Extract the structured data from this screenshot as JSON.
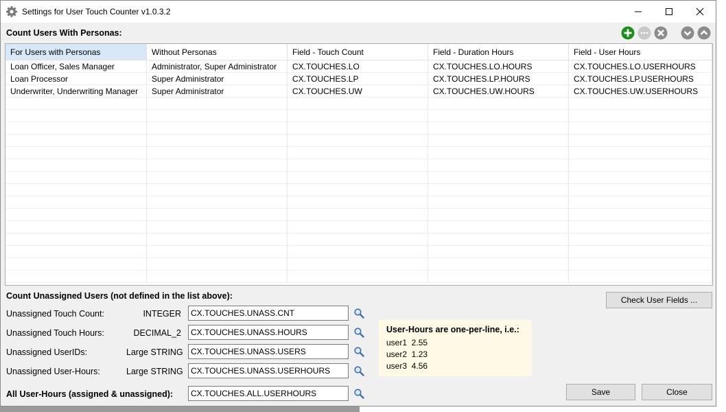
{
  "window": {
    "title": "Settings for User Touch Counter v1.0.3.2",
    "icons": [
      "gear-icon",
      "minimize-icon",
      "maximize-icon",
      "close-icon"
    ]
  },
  "personas": {
    "section_label": "Count Users With Personas:",
    "toolbar_icons": [
      "add-icon",
      "edit-icon",
      "remove-icon",
      "move-down-icon",
      "move-up-icon"
    ],
    "accent_add": "#1a8f1a",
    "columns": [
      "For Users with Personas",
      "Without Personas",
      "Field - Touch Count",
      "Field - Duration Hours",
      "Field - User Hours"
    ],
    "rows": [
      [
        "Loan Officer, Sales Manager",
        "Administrator, Super Administrator",
        "CX.TOUCHES.LO",
        "CX.TOUCHES.LO.HOURS",
        "CX.TOUCHES.LO.USERHOURS"
      ],
      [
        "Loan Processor",
        "Super Administrator",
        "CX.TOUCHES.LP",
        "CX.TOUCHES.LP.HOURS",
        "CX.TOUCHES.LP.USERHOURS"
      ],
      [
        "Underwriter, Underwriting Manager",
        "Super Administrator",
        "CX.TOUCHES.UW",
        "CX.TOUCHES.UW.HOURS",
        "CX.TOUCHES.UW.USERHOURS"
      ]
    ]
  },
  "unassigned": {
    "section_label": "Count Unassigned Users (not defined in the list above):",
    "check_button": "Check User Fields ...",
    "fields": [
      {
        "label": "Unassigned Touch Count:",
        "type": "INTEGER",
        "value": "CX.TOUCHES.UNASS.CNT"
      },
      {
        "label": "Unassigned Touch Hours:",
        "type": "DECIMAL_2",
        "value": "CX.TOUCHES.UNASS.HOURS"
      },
      {
        "label": "Unassigned UserIDs:",
        "type": "Large STRING",
        "value": "CX.TOUCHES.UNASS.USERS"
      },
      {
        "label": "Unassigned User-Hours:",
        "type": "Large STRING",
        "value": "CX.TOUCHES.UNASS.USERHOURS"
      }
    ],
    "all_label": "All User-Hours (assigned & unassigned):",
    "all_value": "CX.TOUCHES.ALL.USERHOURS",
    "lookup_icon": "search-icon"
  },
  "note": {
    "title": "User-Hours are one-per-line, i.e.:",
    "lines": [
      "user1  2.55",
      "user2  1.23",
      "user3  4.56"
    ]
  },
  "buttons": {
    "save": "Save",
    "close": "Close"
  }
}
